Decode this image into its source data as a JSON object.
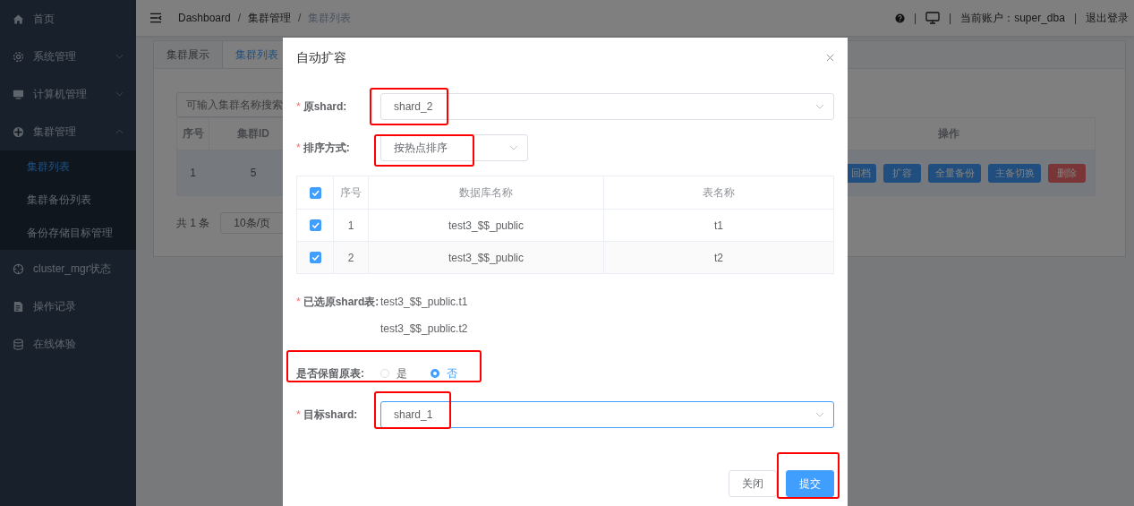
{
  "sidebar": {
    "items": [
      {
        "label": "首页"
      },
      {
        "label": "系统管理",
        "expanded": false
      },
      {
        "label": "计算机管理",
        "expanded": false
      },
      {
        "label": "集群管理",
        "expanded": true,
        "children": [
          {
            "label": "集群列表",
            "selected": true
          },
          {
            "label": "集群备份列表",
            "selected": false
          },
          {
            "label": "备份存储目标管理",
            "selected": false
          }
        ]
      },
      {
        "label": "cluster_mgr状态"
      },
      {
        "label": "操作记录"
      },
      {
        "label": "在线体验"
      }
    ]
  },
  "header": {
    "breadcrumb": [
      "Dashboard",
      "集群管理",
      "集群列表"
    ],
    "breadcrumb_separator": "/",
    "divider": "|",
    "account": "当前账户：super_dba",
    "logout": "退出登录"
  },
  "tabs": [
    {
      "label": "集群展示",
      "selected": false
    },
    {
      "label": "集群列表",
      "selected": true
    }
  ],
  "search": {
    "placeholder": "可输入集群名称搜索"
  },
  "table": {
    "columns": [
      "序号",
      "集群ID",
      "操作"
    ],
    "rows": [
      {
        "cells": [
          "1",
          "5"
        ],
        "actions": [
          {
            "label": "回档",
            "kind": "primary"
          },
          {
            "label": "扩容",
            "kind": "primary"
          },
          {
            "label": "全量备份",
            "kind": "primary"
          },
          {
            "label": "主备切换",
            "kind": "primary"
          },
          {
            "label": "删除",
            "kind": "danger"
          }
        ]
      }
    ]
  },
  "pagination": {
    "total": "共 1 条",
    "page_size": "10条/页"
  },
  "dialog": {
    "title": "自动扩容",
    "required_mark": "*",
    "source_shard": {
      "label": "原shard:",
      "required": true,
      "value": "shard_2"
    },
    "sort": {
      "label": "排序方式:",
      "required": true,
      "value": "按热点排序"
    },
    "tables": {
      "all_checked": true,
      "columns": [
        "序号",
        "数据库名称",
        "表名称"
      ],
      "rows": [
        {
          "checked": true,
          "cells": [
            "1",
            "test3_$$_public",
            "t1"
          ]
        },
        {
          "checked": true,
          "cells": [
            "2",
            "test3_$$_public",
            "t2"
          ]
        }
      ]
    },
    "selected_tables": {
      "label": "已选原shard表:",
      "required": true,
      "values": [
        "test3_$$_public.t1",
        "test3_$$_public.t2"
      ]
    },
    "keep_original": {
      "label": "是否保留原表:",
      "required": false,
      "options": [
        {
          "label": "是",
          "selected": false
        },
        {
          "label": "否",
          "selected": true
        }
      ]
    },
    "target_shard": {
      "label": "目标shard:",
      "required": true,
      "value": "shard_1"
    },
    "buttons": [
      {
        "label": "关闭",
        "kind": "default"
      },
      {
        "label": "提交",
        "kind": "primary"
      }
    ]
  }
}
